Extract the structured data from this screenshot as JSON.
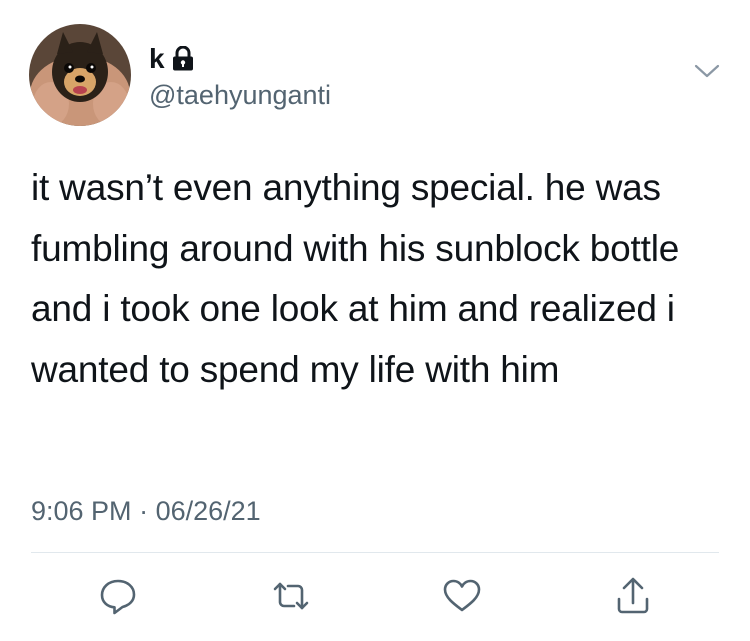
{
  "author": {
    "display_name": "k",
    "handle": "@taehyunganti",
    "avatar_icon": "dog-avatar-icon",
    "protected_icon": "lock-icon"
  },
  "tweet": {
    "text": "it wasn’t even anything special. he was fumbling around with his sunblock bottle and i took one look at him and realized i wanted to spend my life with him",
    "time": "9:06 PM",
    "separator": "·",
    "date": "06/26/21"
  },
  "actions": [
    {
      "name": "reply",
      "icon": "reply-icon"
    },
    {
      "name": "retweet",
      "icon": "retweet-icon"
    },
    {
      "name": "like",
      "icon": "heart-icon"
    },
    {
      "name": "share",
      "icon": "share-icon"
    }
  ],
  "colors": {
    "text_primary": "#0f1419",
    "text_secondary": "#536471",
    "icon": "#536471",
    "divider": "#e1e8ed"
  }
}
